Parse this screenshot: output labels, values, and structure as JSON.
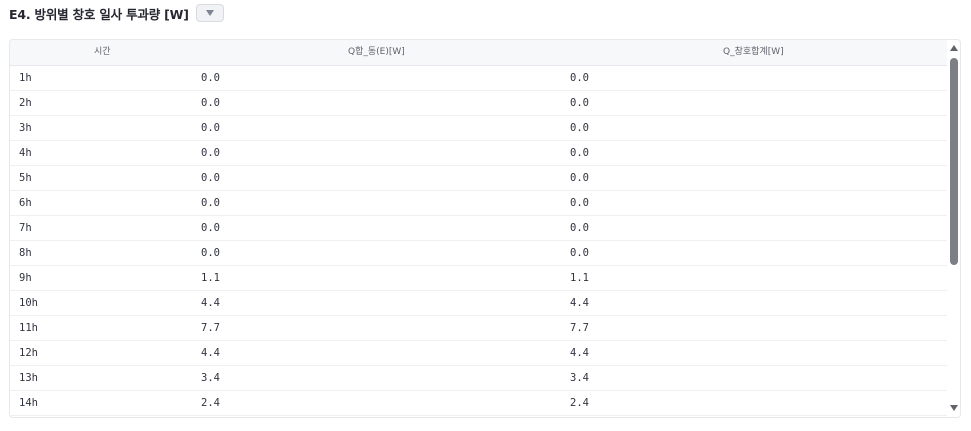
{
  "header": {
    "title": "E4. 방위별 창호 일사 투과량 [W]",
    "dropdown_icon": "triangle-down-icon"
  },
  "table": {
    "columns": [
      "시간",
      "Q합_동(E)[W]",
      "Q_창호합계[W]"
    ],
    "rows": [
      [
        "1h",
        "0.0",
        "0.0"
      ],
      [
        "2h",
        "0.0",
        "0.0"
      ],
      [
        "3h",
        "0.0",
        "0.0"
      ],
      [
        "4h",
        "0.0",
        "0.0"
      ],
      [
        "5h",
        "0.0",
        "0.0"
      ],
      [
        "6h",
        "0.0",
        "0.0"
      ],
      [
        "7h",
        "0.0",
        "0.0"
      ],
      [
        "8h",
        "0.0",
        "0.0"
      ],
      [
        "9h",
        "1.1",
        "1.1"
      ],
      [
        "10h",
        "4.4",
        "4.4"
      ],
      [
        "11h",
        "7.7",
        "7.7"
      ],
      [
        "12h",
        "4.4",
        "4.4"
      ],
      [
        "13h",
        "3.4",
        "3.4"
      ],
      [
        "14h",
        "2.4",
        "2.4"
      ]
    ]
  }
}
